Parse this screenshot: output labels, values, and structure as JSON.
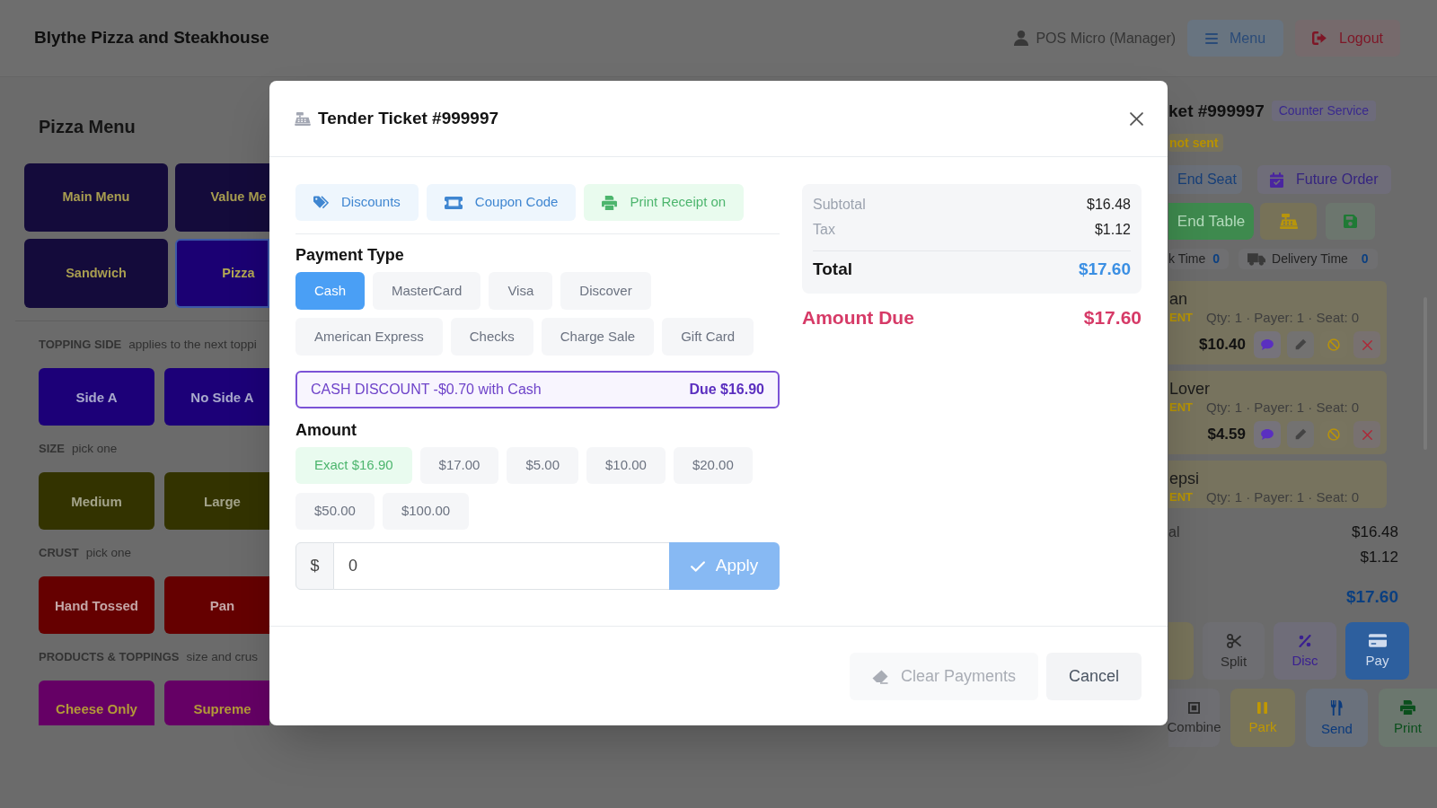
{
  "header": {
    "title": "Blythe Pizza and Steakhouse",
    "user": "POS Micro (Manager)",
    "buttons": [
      {
        "label": "Menu",
        "kind": "menu"
      },
      {
        "label": "Logout",
        "kind": "logout"
      }
    ]
  },
  "menu_panel": {
    "title": "Pizza Menu",
    "categories": [
      {
        "label": "Main Menu",
        "selected": false
      },
      {
        "label": "Value Me",
        "selected": false
      },
      {
        "label": "Sandwich",
        "selected": false
      },
      {
        "label": "Pizza",
        "selected": true
      }
    ],
    "sections": [
      {
        "kind": "side",
        "title": "TOPPING SIDE",
        "hint": "applies to the next toppi",
        "buttons": [
          "Side A",
          "No Side A"
        ]
      },
      {
        "kind": "size",
        "title": "SIZE",
        "hint": "pick one",
        "buttons": [
          "Medium",
          "Large"
        ]
      },
      {
        "kind": "crust",
        "title": "CRUST",
        "hint": "pick one",
        "buttons": [
          "Hand Tossed",
          "Pan"
        ]
      },
      {
        "kind": "product",
        "title": "PRODUCTS & TOPPINGS",
        "hint": "size and crus",
        "buttons": [
          "Cheese Only",
          "Supreme"
        ]
      }
    ]
  },
  "ticket_panel": {
    "title": "ket #999997",
    "service": "Counter Service",
    "status": "not sent",
    "buttons": [
      {
        "label": "End Seat",
        "kind": "end-seat"
      },
      {
        "label": "Future Order",
        "kind": "future-order"
      }
    ],
    "tools": [
      {
        "label": "End Table",
        "kind": "end-table"
      },
      {
        "kind": "register"
      },
      {
        "kind": "save"
      }
    ],
    "timers": [
      {
        "label": "k Time",
        "value": "0",
        "kind": "cook"
      },
      {
        "label": "Delivery Time",
        "value": "0",
        "kind": "delivery"
      }
    ],
    "items": [
      {
        "name": "an",
        "status": "ENT",
        "details": "Qty: 1 · Payer: 1 · Seat: 0",
        "price": "$10.40"
      },
      {
        "name": "Lover",
        "status": "ENT",
        "details": "Qty: 1 · Payer: 1 · Seat: 0",
        "price": "$4.59"
      },
      {
        "name": "epsi",
        "status": "ENT",
        "details": "Qty: 1 · Payer: 1 · Seat: 0"
      }
    ],
    "totals": [
      {
        "label": "al",
        "value": "$16.48"
      },
      {
        "value": "$1.12"
      }
    ],
    "total": "$17.60",
    "action_rows": [
      [
        {
          "kind": "partial"
        },
        {
          "label": "Split",
          "kind": "split"
        },
        {
          "label": "Disc",
          "kind": "disc"
        },
        {
          "label": "Pay",
          "kind": "pay"
        }
      ],
      [
        {
          "label": "Combine",
          "kind": "combine"
        },
        {
          "label": "Park",
          "kind": "park"
        },
        {
          "label": "Send",
          "kind": "send"
        },
        {
          "label": "Print",
          "kind": "print"
        }
      ]
    ]
  },
  "tender_dialog": {
    "title": "Tender Ticket #999997",
    "tools": [
      {
        "label": "Discounts",
        "kind": "discounts"
      },
      {
        "label": "Coupon Code",
        "kind": "coupon"
      },
      {
        "label": "Print Receipt on",
        "kind": "print-receipt"
      }
    ],
    "payment_type": {
      "label": "Payment Type",
      "options": [
        {
          "label": "Cash",
          "selected": true
        },
        {
          "label": "MasterCard",
          "selected": false
        },
        {
          "label": "Visa",
          "selected": false
        },
        {
          "label": "Discover",
          "selected": false
        },
        {
          "label": "American Express",
          "selected": false
        },
        {
          "label": "Checks",
          "selected": false
        },
        {
          "label": "Charge Sale",
          "selected": false
        },
        {
          "label": "Gift Card",
          "selected": false
        }
      ]
    },
    "discount_notice": {
      "text": "CASH DISCOUNT -$0.70 with Cash",
      "due": "Due $16.90"
    },
    "amount": {
      "label": "Amount",
      "presets": [
        {
          "label": "Exact $16.90",
          "kind": "exact"
        },
        {
          "label": "$17.00",
          "kind": "preset"
        },
        {
          "label": "$5.00",
          "kind": "preset"
        },
        {
          "label": "$10.00",
          "kind": "preset"
        },
        {
          "label": "$20.00",
          "kind": "preset"
        },
        {
          "label": "$50.00",
          "kind": "preset"
        },
        {
          "label": "$100.00",
          "kind": "preset"
        }
      ],
      "currency": "$",
      "value": "0",
      "apply": {
        "label": "Apply",
        "disabled": true
      }
    },
    "summary": {
      "rows": [
        {
          "label": "Subtotal",
          "value": "$16.48"
        },
        {
          "label": "Tax",
          "value": "$1.12"
        }
      ],
      "total": {
        "label": "Total",
        "value": "$17.60"
      }
    },
    "amount_due": {
      "label": "Amount Due",
      "value": "$17.60"
    },
    "footer": [
      {
        "label": "Clear Payments",
        "kind": "clear",
        "disabled": true
      },
      {
        "label": "Cancel",
        "kind": "cancel",
        "disabled": false
      }
    ]
  }
}
